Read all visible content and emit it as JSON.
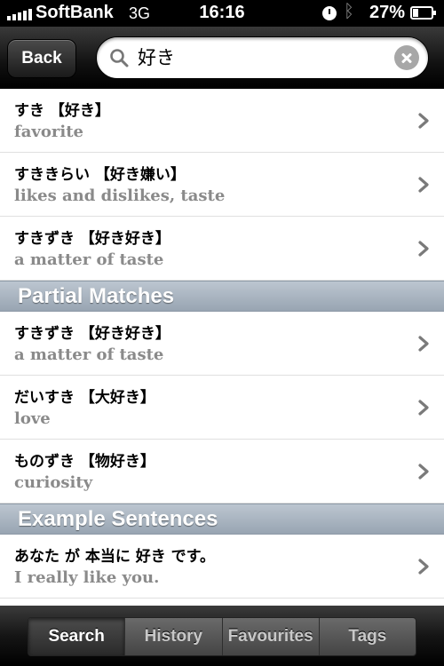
{
  "status_bar": {
    "carrier": "SoftBank",
    "network": "3G",
    "time": "16:16",
    "battery": "27%",
    "battery_level": 0.27
  },
  "search": {
    "back_label": "Back",
    "query": "好き"
  },
  "results": [
    {
      "jp": "すき 【好き】",
      "en": "favorite"
    },
    {
      "jp": "すききらい 【好き嫌い】",
      "en": "likes and dislikes, taste"
    },
    {
      "jp": "すきずき 【好き好き】",
      "en": "a matter of taste"
    }
  ],
  "partial_matches": {
    "header": "Partial Matches",
    "items": [
      {
        "jp": "すきずき 【好き好き】",
        "en": "a matter of taste"
      },
      {
        "jp": "だいすき 【大好き】",
        "en": "love"
      },
      {
        "jp": "ものずき 【物好き】",
        "en": "curiosity"
      }
    ]
  },
  "example_sentences": {
    "header": "Example Sentences",
    "items": [
      {
        "jp": "あなた が 本当に 好き です。",
        "en": "I really like you."
      }
    ]
  },
  "tabs": [
    {
      "label": "Search",
      "active": true
    },
    {
      "label": "History",
      "active": false
    },
    {
      "label": "Favourites",
      "active": false
    },
    {
      "label": "Tags",
      "active": false
    }
  ]
}
